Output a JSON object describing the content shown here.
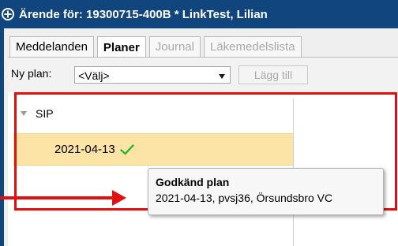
{
  "window": {
    "title": "Ärende för: 19300715-400B * LinkTest, Lilian",
    "icon": "plus-circle-icon",
    "title_bar_color": "#11457d"
  },
  "tabs": [
    {
      "label": "Meddelanden",
      "state": "normal"
    },
    {
      "label": "Planer",
      "state": "active"
    },
    {
      "label": "Journal",
      "state": "disabled"
    },
    {
      "label": "Läkemedelslista",
      "state": "disabled"
    }
  ],
  "new_plan": {
    "label": "Ny plan:",
    "selected": "<Välj>",
    "add_button": "Lägg till"
  },
  "tree": {
    "group": "SIP",
    "items": [
      {
        "date": "2021-04-13",
        "status_icon": "checkmark-icon"
      }
    ],
    "selected_color": "#fce4a6"
  },
  "tooltip": {
    "title": "Godkänd plan",
    "body": "2021-04-13, pvsj36, Örsundsbro VC"
  },
  "annotation": {
    "color": "#e01010"
  }
}
